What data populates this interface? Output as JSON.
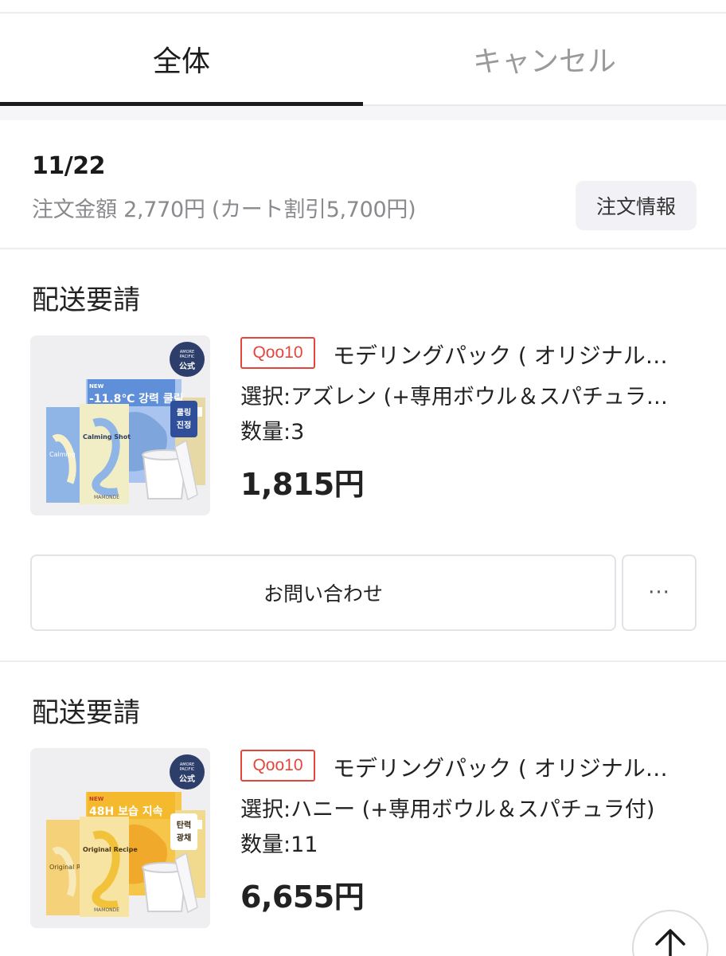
{
  "tabs": {
    "all": "全体",
    "cancel": "キャンセル"
  },
  "order": {
    "date": "11/22",
    "amount": "注文金額 2,770円 (カート割引5,700円)",
    "info_button": "注文情報"
  },
  "items": [
    {
      "status": "配送要請",
      "badge": "Qoo10",
      "name": "モデリングパック ( オリジナル…",
      "option": "選択:アズレン (+専用ボウル＆スパチュラ…",
      "quantity": "数量:3",
      "price": "1,815円",
      "image_text": {
        "brand_top": "AMORE",
        "brand_bottom": "PACIFIC",
        "official": "公式",
        "new": "NEW",
        "headline": "-11.8℃ 강력 쿨링",
        "sticker_1": "쿨링",
        "sticker_2": "진정",
        "pack_1": "Calming",
        "pack_2": "Calming Shot",
        "brand": "MAMONDE"
      },
      "inquiry_button": "お問い合わせ",
      "more_button": "···"
    },
    {
      "status": "配送要請",
      "badge": "Qoo10",
      "name": "モデリングパック ( オリジナル…",
      "option": "選択:ハニー (+専用ボウル＆スパチュラ付)",
      "quantity": "数量:11",
      "price": "6,655円",
      "image_text": {
        "brand_top": "AMORE",
        "brand_bottom": "PACIFIC",
        "official": "公式",
        "new": "NEW",
        "headline": "48H 보습 지속",
        "sticker_1": "탄력",
        "sticker_2": "광채",
        "pack_1": "Original R",
        "pack_2": "Original Recipe",
        "brand": "MAMONDE"
      }
    }
  ],
  "colors": {
    "accent_red": "#e4463c",
    "text_dark": "#222222",
    "text_muted": "#8a8a8e",
    "tab_inactive": "#9a9a9a",
    "pack_blue": "#8fb4e6",
    "pack_yellow": "#f2c23a"
  },
  "icons": {
    "scroll_top": "arrow-up-icon"
  }
}
